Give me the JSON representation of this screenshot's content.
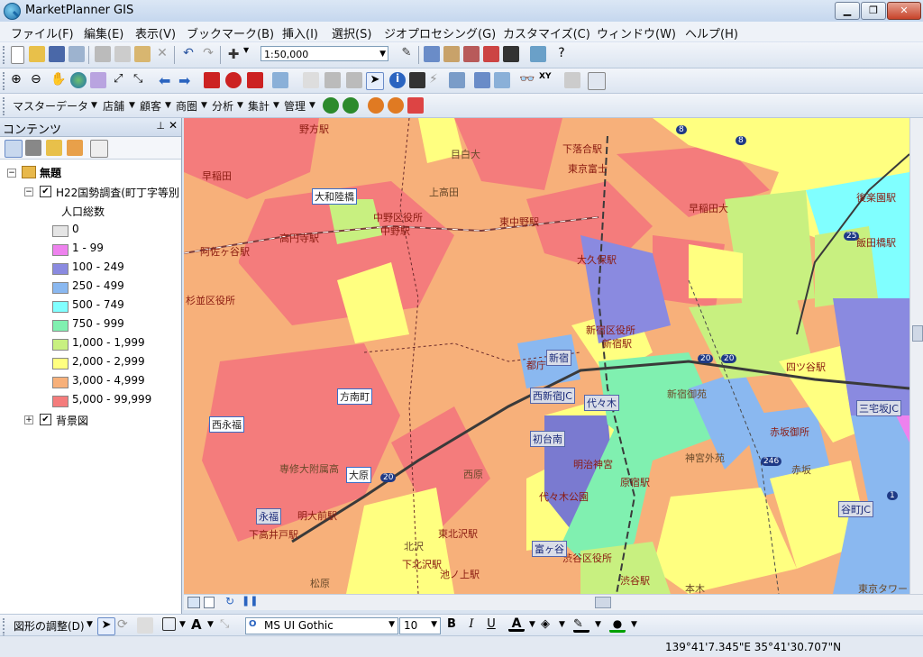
{
  "window": {
    "title": "MarketPlanner GIS"
  },
  "menu": [
    "ファイル(F)",
    "編集(E)",
    "表示(V)",
    "ブックマーク(B)",
    "挿入(I)",
    "選択(S)",
    "ジオプロセシング(G)",
    "カスタマイズ(C)",
    "ウィンドウ(W)",
    "ヘルプ(H)"
  ],
  "toolbar": {
    "scale": "1:50,000"
  },
  "commands": [
    "マスターデータ",
    "店舗",
    "顧客",
    "商圏",
    "分析",
    "集計",
    "管理"
  ],
  "toc": {
    "title": "コンテンツ",
    "root": "無題",
    "layer": "H22国勢調査(町丁字等別",
    "field": "人口総数",
    "legend": [
      {
        "label": "0",
        "color": "#e5e5e5"
      },
      {
        "label": "1 - 99",
        "color": "#ee82ee"
      },
      {
        "label": "100 - 249",
        "color": "#8a8ae0"
      },
      {
        "label": "250 - 499",
        "color": "#8ab8f0"
      },
      {
        "label": "500 - 749",
        "color": "#80ffff"
      },
      {
        "label": "750 - 999",
        "color": "#80f0b0"
      },
      {
        "label": "1,000 - 1,999",
        "color": "#c8f080"
      },
      {
        "label": "2,000 - 2,999",
        "color": "#ffff80"
      },
      {
        "label": "3,000 - 4,999",
        "color": "#f7b07a"
      },
      {
        "label": "5,000 - 99,999",
        "color": "#f47c7c"
      }
    ],
    "background_layer": "背景図"
  },
  "map_labels": {
    "stations": [
      "野方駅",
      "下落合駅",
      "東京富士",
      "早稲田",
      "高円寺駅",
      "中野駅",
      "東中野駅",
      "大久保駅",
      "早稲田大",
      "後楽園駅",
      "飯田橋駅",
      "阿佐ヶ谷駅",
      "新宿区役所",
      "新宿駅",
      "四ツ谷駅",
      "都庁",
      "明治神宮",
      "代々木公園",
      "原宿駅",
      "明大前駅",
      "下高井戸駅",
      "東北沢駅",
      "下北沢駅",
      "池ノ上駅",
      "渋谷区役所",
      "渋谷駅",
      "中野区役所",
      "杉並区役所",
      "赤坂御所"
    ],
    "boxed": [
      "大和陸橋",
      "方南町",
      "西永福",
      "大原",
      "永福",
      "新宿",
      "西新宿JC",
      "代々木",
      "初台南",
      "三宅坂JC",
      "谷町JC",
      "富ヶ谷"
    ],
    "areas": [
      "目白大",
      "上高田",
      "専修大附属高",
      "西原",
      "北沢",
      "松原",
      "神宮外苑",
      "赤坂",
      "新宿御苑",
      "本木",
      "東京タワー"
    ]
  },
  "route_numbers": [
    "20",
    "20",
    "20",
    "246",
    "25",
    "8",
    "1",
    "8"
  ],
  "drawing": {
    "label": "図形の調整(D)",
    "font": "MS UI Gothic",
    "size": "10"
  },
  "status": {
    "coords": "139°41'7.345\"E  35°41'30.707\"N"
  }
}
